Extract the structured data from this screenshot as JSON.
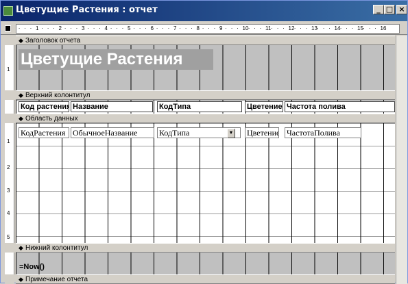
{
  "window": {
    "title": "Цветущие Растения : отчет",
    "min_label": "_",
    "max_label": "□",
    "close_label": "×"
  },
  "hruler": {
    "ticks": [
      "1",
      "2",
      "3",
      "4",
      "5",
      "6",
      "7",
      "8",
      "9",
      "10",
      "11",
      "12",
      "13",
      "14",
      "15",
      "16"
    ]
  },
  "vruler": {
    "ticks": [
      "1",
      "1",
      "2",
      "3",
      "4",
      "5"
    ]
  },
  "sections": {
    "report_header": "Заголовок отчета",
    "page_header": "Верхний колонтитул",
    "detail": "Область данных",
    "page_footer": "Нижний колонтитул",
    "report_footer": "Примечание отчета"
  },
  "report_title": "Цветущие Растения",
  "header_labels": [
    "Код растения",
    "Название",
    "КодТипа",
    "Цветение",
    "Частота полива"
  ],
  "detail_fields": [
    "КодРастения",
    "ОбычноеНазвание",
    "КодТипа",
    "Цветение",
    "ЧастотаПолива"
  ],
  "footer_expression": "=Now()",
  "band_arrow": "◆"
}
